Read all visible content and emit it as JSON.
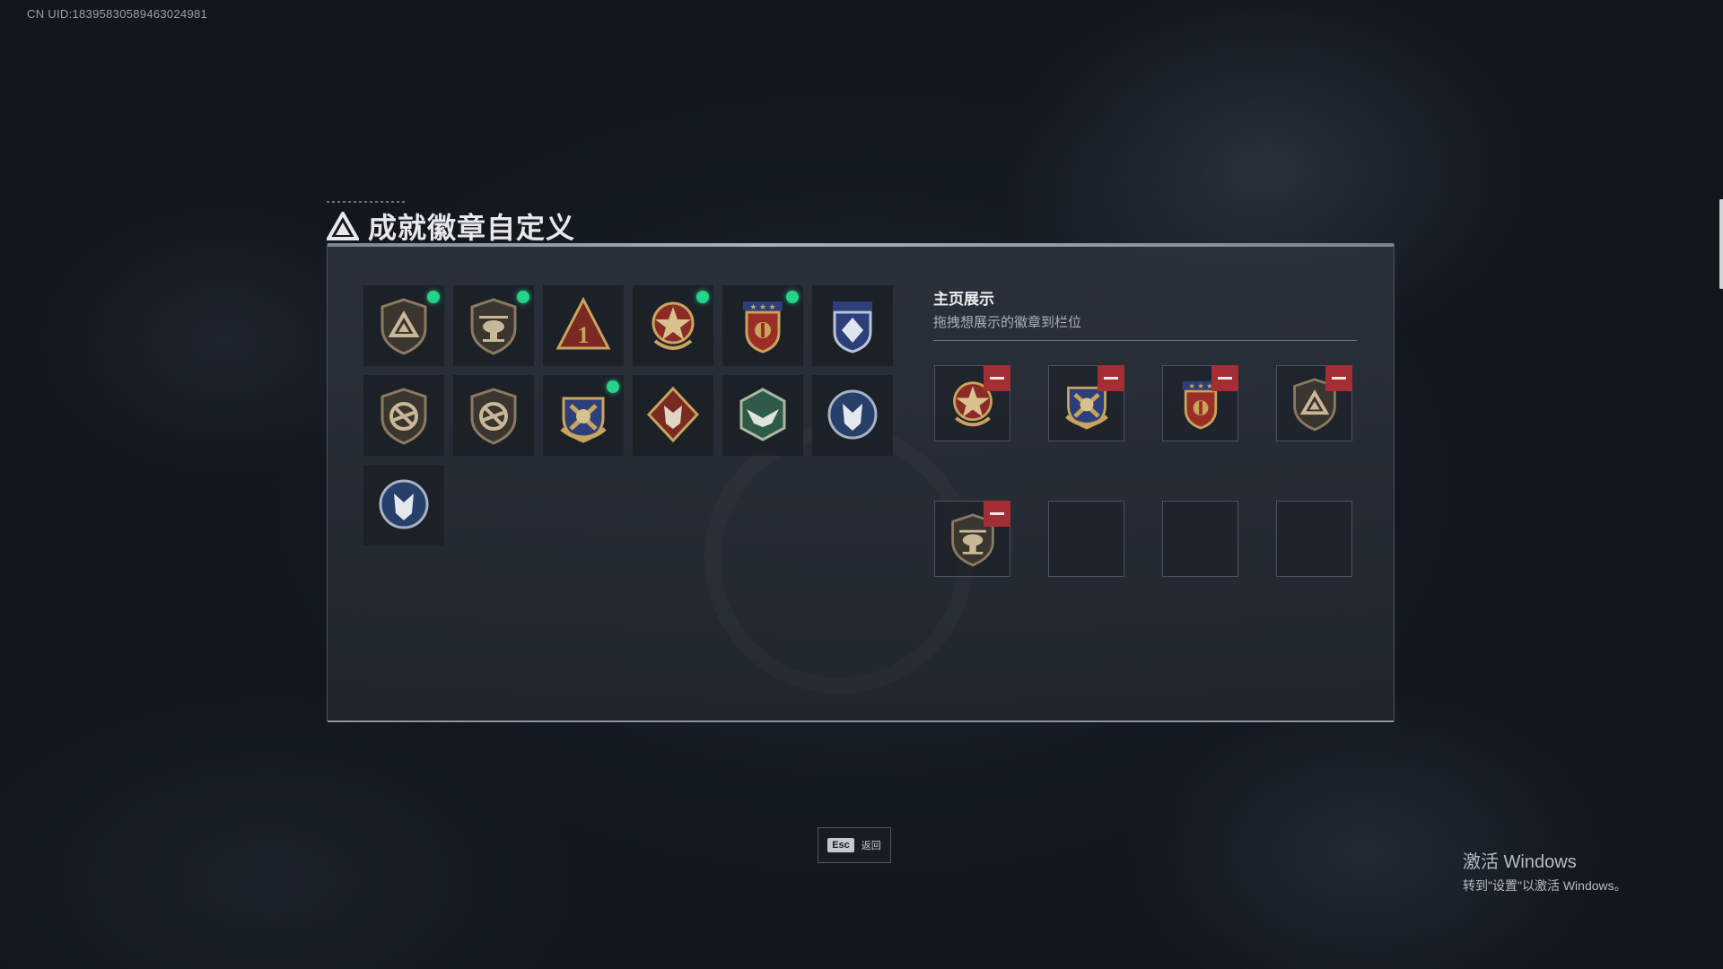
{
  "uid_text": "CN UID:18395830589463024981",
  "title": "成就徽章自定义",
  "display": {
    "title": "主页展示",
    "subtitle": "拖拽想展示的徽章到栏位"
  },
  "colors": {
    "new_indicator": "#25d38a",
    "remove_button": "#a32e34",
    "gold": "#c9a45c"
  },
  "badges": [
    {
      "icon": "triangle-shield-badge-icon",
      "new": true
    },
    {
      "icon": "helicopter-shield-badge-icon",
      "new": true
    },
    {
      "icon": "rank-one-triangle-badge-icon",
      "new": false
    },
    {
      "icon": "star-wreath-badge-icon",
      "new": true
    },
    {
      "icon": "stars-crest-badge-icon",
      "new": true
    },
    {
      "icon": "diamond-crest-badge-icon",
      "new": false
    },
    {
      "icon": "no-rifle-shield-badge-icon",
      "new": false
    },
    {
      "icon": "no-rifle-shield-badge-icon",
      "new": false
    },
    {
      "icon": "anchor-cross-badge-icon",
      "new": true
    },
    {
      "icon": "wolf-diamond-badge-icon",
      "new": false
    },
    {
      "icon": "eagle-hexagon-badge-icon",
      "new": false
    },
    {
      "icon": "wolf-circle-badge-icon",
      "new": false
    },
    {
      "icon": "wolf-circle-badge-icon",
      "new": false
    }
  ],
  "display_slots": [
    {
      "icon": "star-wreath-badge-icon",
      "filled": true
    },
    {
      "icon": "anchor-cross-badge-icon",
      "filled": true
    },
    {
      "icon": "stars-crest-badge-icon",
      "filled": true
    },
    {
      "icon": "triangle-shield-badge-icon",
      "filled": true
    },
    {
      "icon": "helicopter-shield-badge-icon",
      "filled": true
    },
    {
      "filled": false
    },
    {
      "filled": false
    },
    {
      "filled": false
    }
  ],
  "esc": {
    "key": "Esc",
    "label": "返回"
  },
  "watermark": {
    "line1": "激活 Windows",
    "line2": "转到\"设置\"以激活 Windows。"
  }
}
